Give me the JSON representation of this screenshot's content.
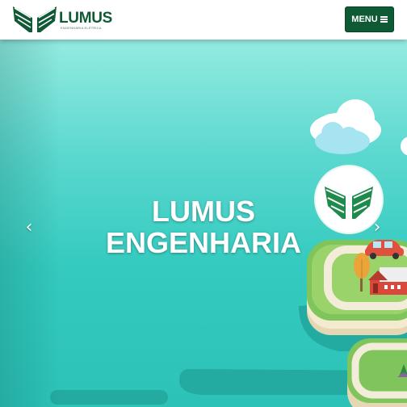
{
  "header": {
    "logo": {
      "name": "LUMUS",
      "tagline": "ENGENHARIA ELÉTRICA",
      "icon": "wings-emblem-icon",
      "color": "#0f5a35"
    },
    "menu_button": {
      "label": "MENU",
      "icon": "hamburger-icon",
      "color": "#0f5a35"
    }
  },
  "carousel": {
    "slide": {
      "title_line1": "LUMUS",
      "title_line2": "ENGENHARIA"
    },
    "prev_icon": "chevron-left-icon",
    "next_icon": "chevron-right-icon",
    "colors": {
      "sky_top": "#94ebe1",
      "sky_bottom": "#2cc2b8",
      "grass": "#7fc55b"
    }
  }
}
